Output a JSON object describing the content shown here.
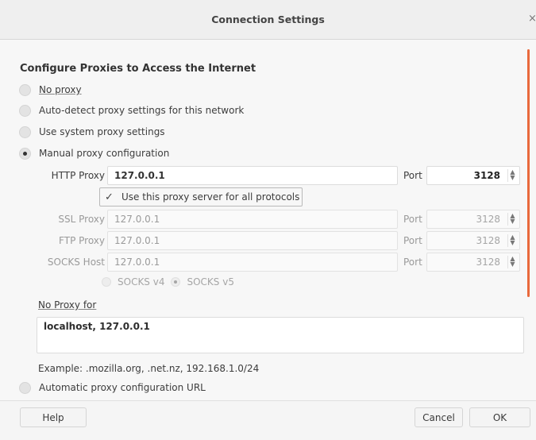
{
  "window": {
    "title": "Connection Settings",
    "close_label": "×"
  },
  "heading": "Configure Proxies to Access the Internet",
  "proxy_options": [
    {
      "label": "No proxy",
      "checked": false
    },
    {
      "label": "Auto-detect proxy settings for this network",
      "checked": false
    },
    {
      "label": "Use system proxy settings",
      "checked": false
    },
    {
      "label": "Manual proxy configuration",
      "checked": true
    }
  ],
  "manual": {
    "http": {
      "label": "HTTP Proxy",
      "value": "127.0.0.1",
      "port_label": "Port",
      "port": "3128"
    },
    "use_for_all": {
      "label": "Use this proxy server for all protocols",
      "checked": true
    },
    "ssl": {
      "label": "SSL Proxy",
      "value": "127.0.0.1",
      "port_label": "Port",
      "port": "3128"
    },
    "ftp": {
      "label": "FTP Proxy",
      "value": "127.0.0.1",
      "port_label": "Port",
      "port": "3128"
    },
    "socks": {
      "label": "SOCKS Host",
      "value": "127.0.0.1",
      "port_label": "Port",
      "port": "3128"
    },
    "socks_versions": [
      {
        "label": "SOCKS v4",
        "checked": false
      },
      {
        "label": "SOCKS v5",
        "checked": true
      }
    ]
  },
  "no_proxy": {
    "label": "No Proxy for",
    "value": "localhost, 127.0.0.1",
    "example": "Example: .mozilla.org, .net.nz, 192.168.1.0/24"
  },
  "auto_config": {
    "label": "Automatic proxy configuration URL",
    "checked": false
  },
  "buttons": {
    "help": "Help",
    "cancel": "Cancel",
    "ok": "OK"
  },
  "colors": {
    "accent": "#e9693c",
    "background": "#f7f7f7"
  }
}
